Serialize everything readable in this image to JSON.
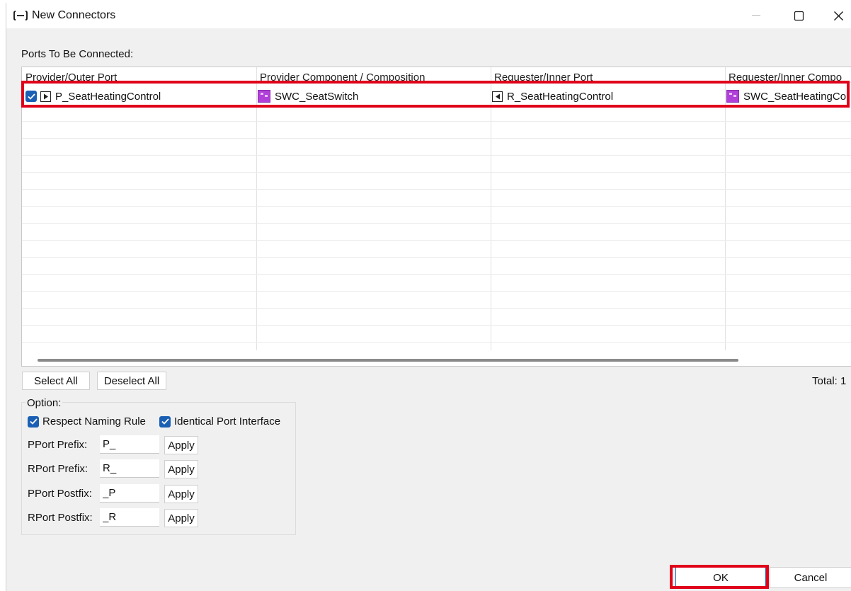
{
  "window": {
    "title": "New Connectors"
  },
  "ports_label": "Ports To Be Connected:",
  "table": {
    "columns": [
      "Provider/Outer Port",
      "Provider Component / Composition",
      "Requester/Inner Port",
      "Requester/Inner Compo"
    ],
    "rows": [
      {
        "checked": true,
        "provider_port": "P_SeatHeatingControl",
        "provider_component": "SWC_SeatSwitch",
        "requester_port": "R_SeatHeatingControl",
        "requester_component": "SWC_SeatHeatingCo"
      }
    ]
  },
  "buttons": {
    "select_all": "Select All",
    "deselect_all": "Deselect All",
    "ok": "OK",
    "cancel": "Cancel",
    "apply": "Apply"
  },
  "total": "Total: 1",
  "options": {
    "title": "Option:",
    "respect_naming_rule": {
      "label": "Respect Naming Rule",
      "checked": true
    },
    "identical_port_interface": {
      "label": "Identical Port Interface",
      "checked": true
    },
    "fields": [
      {
        "label": "PPort Prefix:",
        "value": "P_"
      },
      {
        "label": "RPort Prefix:",
        "value": "R_"
      },
      {
        "label": "PPort Postfix:",
        "value": "_P"
      },
      {
        "label": "RPort Postfix:",
        "value": "_R"
      }
    ]
  },
  "colors": {
    "accent": "#1a5fb4",
    "highlight": "#e0001a",
    "component_icon": "#b040d8"
  }
}
